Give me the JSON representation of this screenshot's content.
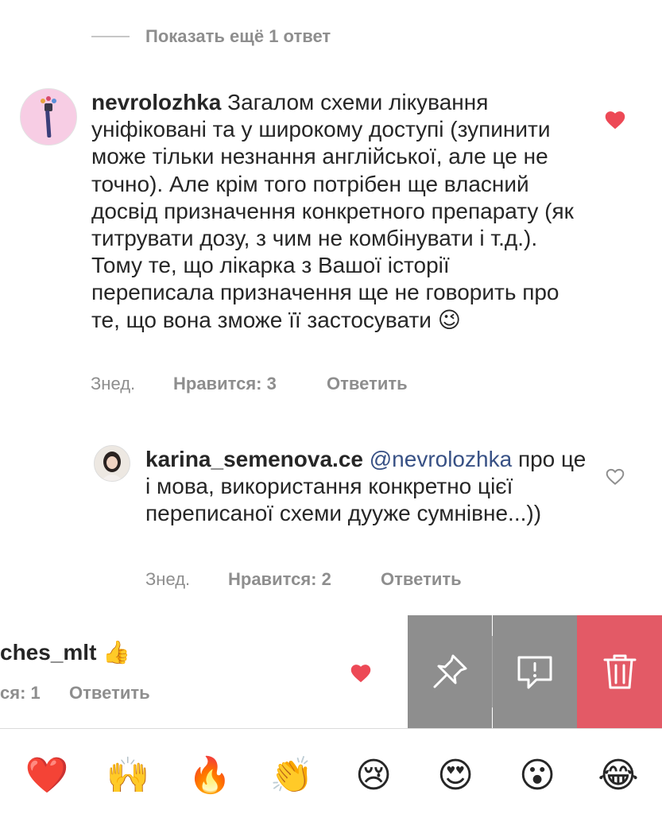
{
  "show_more": {
    "label": "Показать ещё 1 ответ"
  },
  "comment1": {
    "username": "nevrolozhka",
    "text": "Загалом схеми лікування уніфіковані та у широкому доступі (зупинити може тільки незнання англійської, але це не точно). Але крім того потрібен ще власний досвід призначення конкретного препарату (як титрувати дозу, з чим не комбінувати і т.д.). Тому те, що лікарка з Вашої історії переписала призначення ще не говорить про те, що вона зможе її застосувати",
    "emoji": "😉",
    "time": "Знед.",
    "likes": "Нравится: 3",
    "reply": "Ответить",
    "liked": true
  },
  "comment2": {
    "username": "karina_semenova.ce",
    "mention": "@nevrolozhka",
    "text": "про це і мова, використання конкретно цієї переписаної схеми дууже сумнівне...))",
    "time": "Знед.",
    "likes": "Нравится: 2",
    "reply": "Ответить",
    "liked": false
  },
  "comment3": {
    "username_partial": "ches_mlt",
    "emoji": "👍",
    "likes_partial": "ся: 1",
    "reply": "Ответить",
    "liked": true
  },
  "actions": {
    "pin": "pin-icon",
    "report": "report-icon",
    "delete": "trash-icon",
    "colors": {
      "gray": "#8e8e8e",
      "delete": "#e35a66"
    }
  },
  "quick_emojis": [
    "❤️",
    "🙌",
    "🔥",
    "👏",
    "😢",
    "😍",
    "😮",
    "😂"
  ],
  "colors": {
    "heart": "#ed4956",
    "secondary_text": "#8e8e8e",
    "mention": "#385185"
  }
}
